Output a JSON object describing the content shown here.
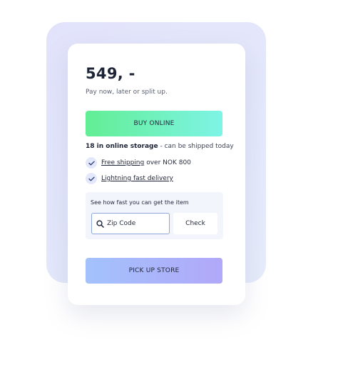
{
  "product": {
    "price": "549, -",
    "payment_note": "Pay now, later or split up."
  },
  "buy_button": {
    "label": "BUY ONLINE"
  },
  "stock": {
    "count_label": "18 in online storage",
    "note": " - can be shipped today"
  },
  "perks": [
    {
      "icon": "checkmark-icon",
      "link": "Free shipping",
      "text": "over NOK 800"
    },
    {
      "icon": "checkmark-icon",
      "link": "Lightning fast delivery",
      "text": ""
    }
  ],
  "delivery_check": {
    "title": "See how fast you can get the item",
    "zip_placeholder": "Zip Code",
    "zip_value": "",
    "check_label": "Check"
  },
  "pickup_button": {
    "label": "PICK UP STORE"
  },
  "colors": {
    "buy_gradient": [
      "#62ee94",
      "#7ef4e6"
    ],
    "pickup_gradient": [
      "#a3c2fc",
      "#b1a8f9"
    ],
    "backdrop": "#e4e7fb",
    "text_dark": "#1f2538"
  }
}
